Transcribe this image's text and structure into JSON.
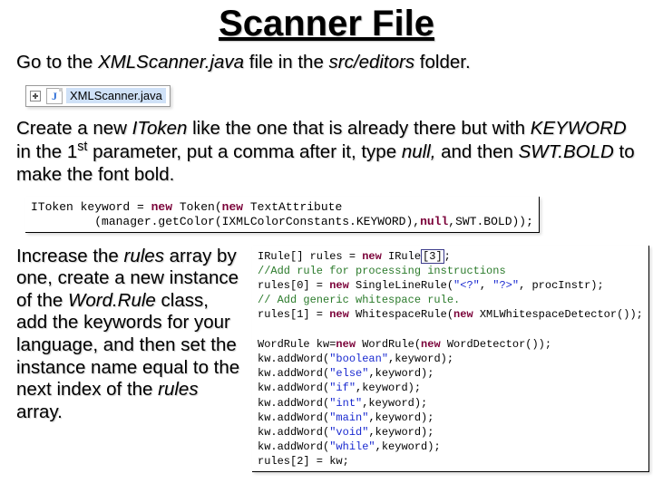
{
  "title": "Scanner File",
  "para1": {
    "pre": "Go to the ",
    "file": "XMLScanner.java",
    "mid": " file in the ",
    "folder": "src/editors",
    "post": " folder."
  },
  "fileRow": {
    "name": "XMLScanner.java"
  },
  "para2": {
    "a": "Create a new ",
    "b": "IToken",
    "c": " like the one that is already there but with ",
    "d": "KEYWORD",
    "e": " in the 1",
    "f": "st",
    "g": " parameter, put a comma after it, type ",
    "h": "null,",
    "i": " and then ",
    "j": "SWT.BOLD",
    "k": "  to make the font bold."
  },
  "code1": {
    "l1a": "IToken keyword = ",
    "l1b": "new",
    "l1c": " Token(",
    "l1d": "new",
    "l1e": " TextAttribute",
    "l2a": "         (manager.getColor(IXMLColorConstants.KEYWORD),",
    "l2b": "null",
    "l2c": ",SWT.BOLD));"
  },
  "para3": {
    "a": "Increase the ",
    "b": "rules",
    "c": " array by one, create a new instance of the ",
    "d": "Word.Rule",
    "e": " class, add the keywords for your language, and then set the instance name equal to the next index of the ",
    "f": "rules",
    "g": " array."
  },
  "code2": {
    "l1a": "IRule[] rules = ",
    "l1b": "new",
    "l1c": " IRule",
    "l1d": "[3]",
    "l1e": ";",
    "l2": "//Add rule for processing instructions",
    "l3a": "rules[0] = ",
    "l3b": "new",
    "l3c": " SingleLineRule(",
    "l3d": "\"<?\"",
    "l3e": ", ",
    "l3f": "\"?>\"",
    "l3g": ", procInstr);",
    "l4": "// Add generic whitespace rule.",
    "l5a": "rules[1] = ",
    "l5b": "new",
    "l5c": " WhitespaceRule(",
    "l5d": "new",
    "l5e": " XMLWhitespaceDetector());",
    "blank": "",
    "l6a": "WordRule kw=",
    "l6b": "new",
    "l6c": " WordRule(",
    "l6d": "new",
    "l6e": " WordDetector());",
    "l7a": "kw.addWord(",
    "l7b": "\"boolean\"",
    "l7c": ",keyword);",
    "l8a": "kw.addWord(",
    "l8b": "\"else\"",
    "l8c": ",keyword);",
    "l9a": "kw.addWord(",
    "l9b": "\"if\"",
    "l9c": ",keyword);",
    "l10a": "kw.addWord(",
    "l10b": "\"int\"",
    "l10c": ",keyword);",
    "l11a": "kw.addWord(",
    "l11b": "\"main\"",
    "l11c": ",keyword);",
    "l12a": "kw.addWord(",
    "l12b": "\"void\"",
    "l12c": ",keyword);",
    "l13a": "kw.addWord(",
    "l13b": "\"while\"",
    "l13c": ",keyword);",
    "l14": "rules[2] = kw;"
  }
}
